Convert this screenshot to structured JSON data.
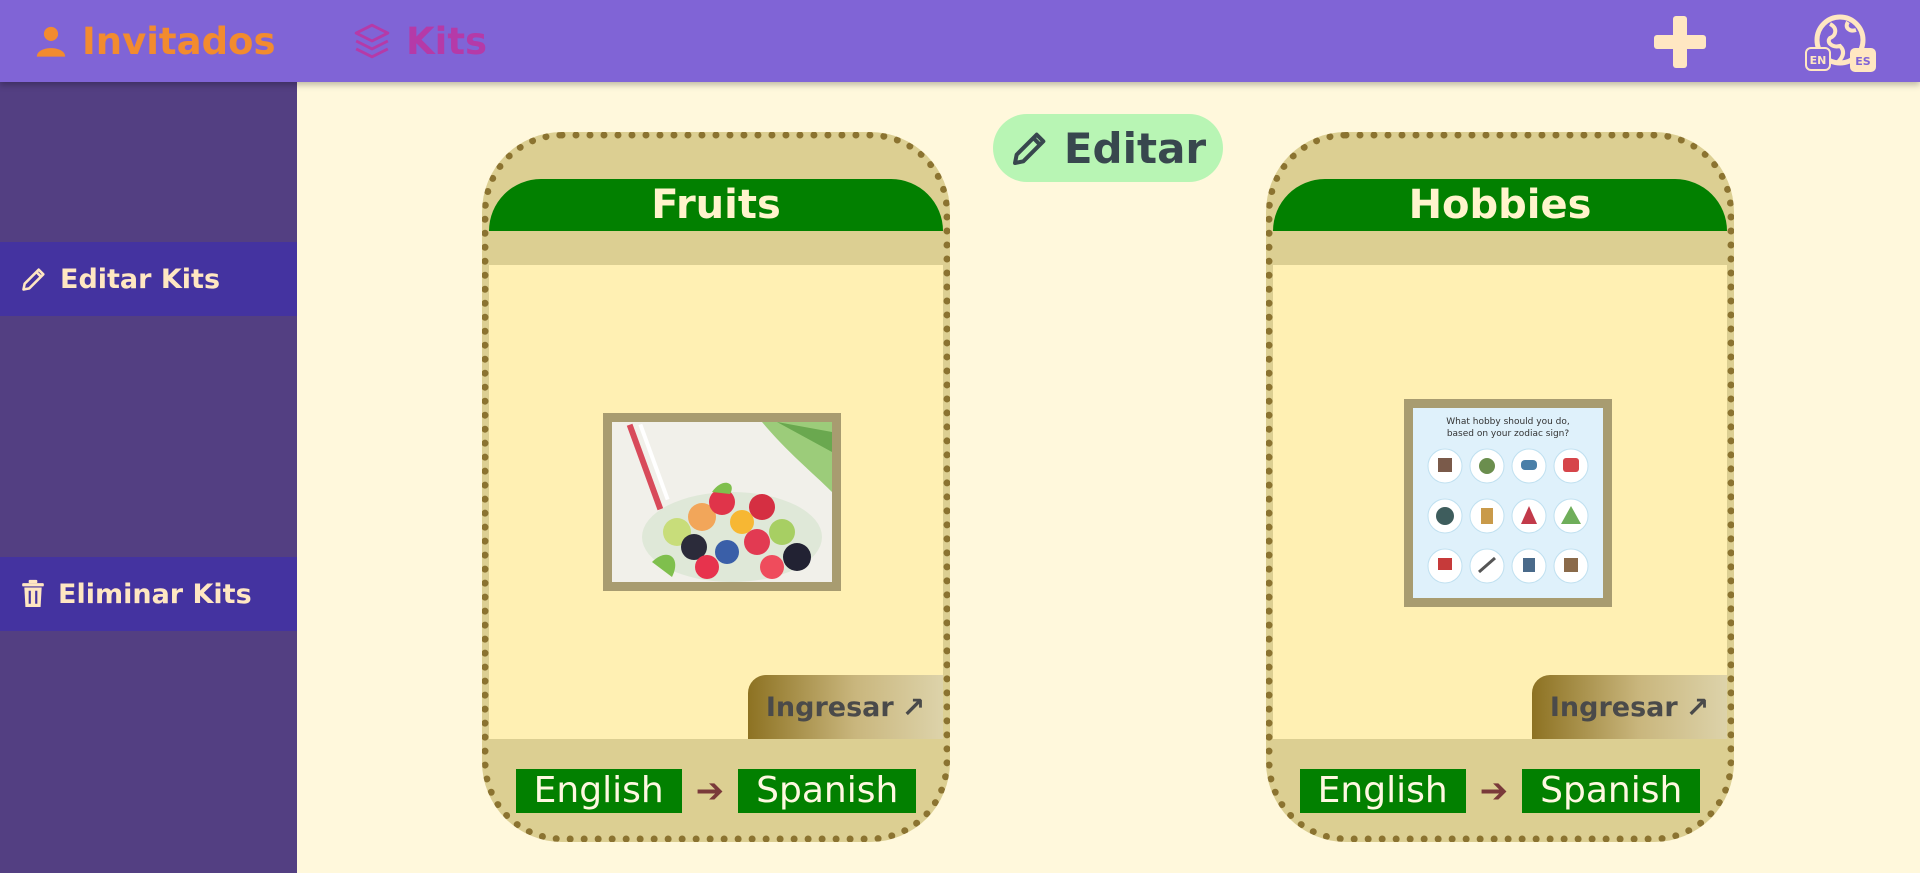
{
  "nav": {
    "guests_label": "Invitados",
    "kits_label": "Kits"
  },
  "lang_switch": {
    "from": "EN",
    "to": "ES"
  },
  "sidebar": {
    "edit_label": "Editar Kits",
    "delete_label": "Eliminar Kits"
  },
  "edit_pill": {
    "label": "Editar"
  },
  "kits": [
    {
      "title": "Fruits",
      "enter_label": "Ingresar",
      "enter_arrow": "↗",
      "source_lang": "English",
      "target_lang": "Spanish",
      "arrow": "➔"
    },
    {
      "title": "Hobbies",
      "enter_label": "Ingresar",
      "enter_arrow": "↗",
      "source_lang": "English",
      "target_lang": "Spanish",
      "arrow": "➔",
      "image_text": {
        "line1": "What hobby should you do,",
        "line2": "based on your zodiac sign?"
      }
    }
  ],
  "colors": {
    "topbar": "#8064d6",
    "sidebar": "#533f82",
    "sidebar_item": "#4433a0",
    "card_title": "#028000",
    "page_bg": "#fff8dc"
  }
}
